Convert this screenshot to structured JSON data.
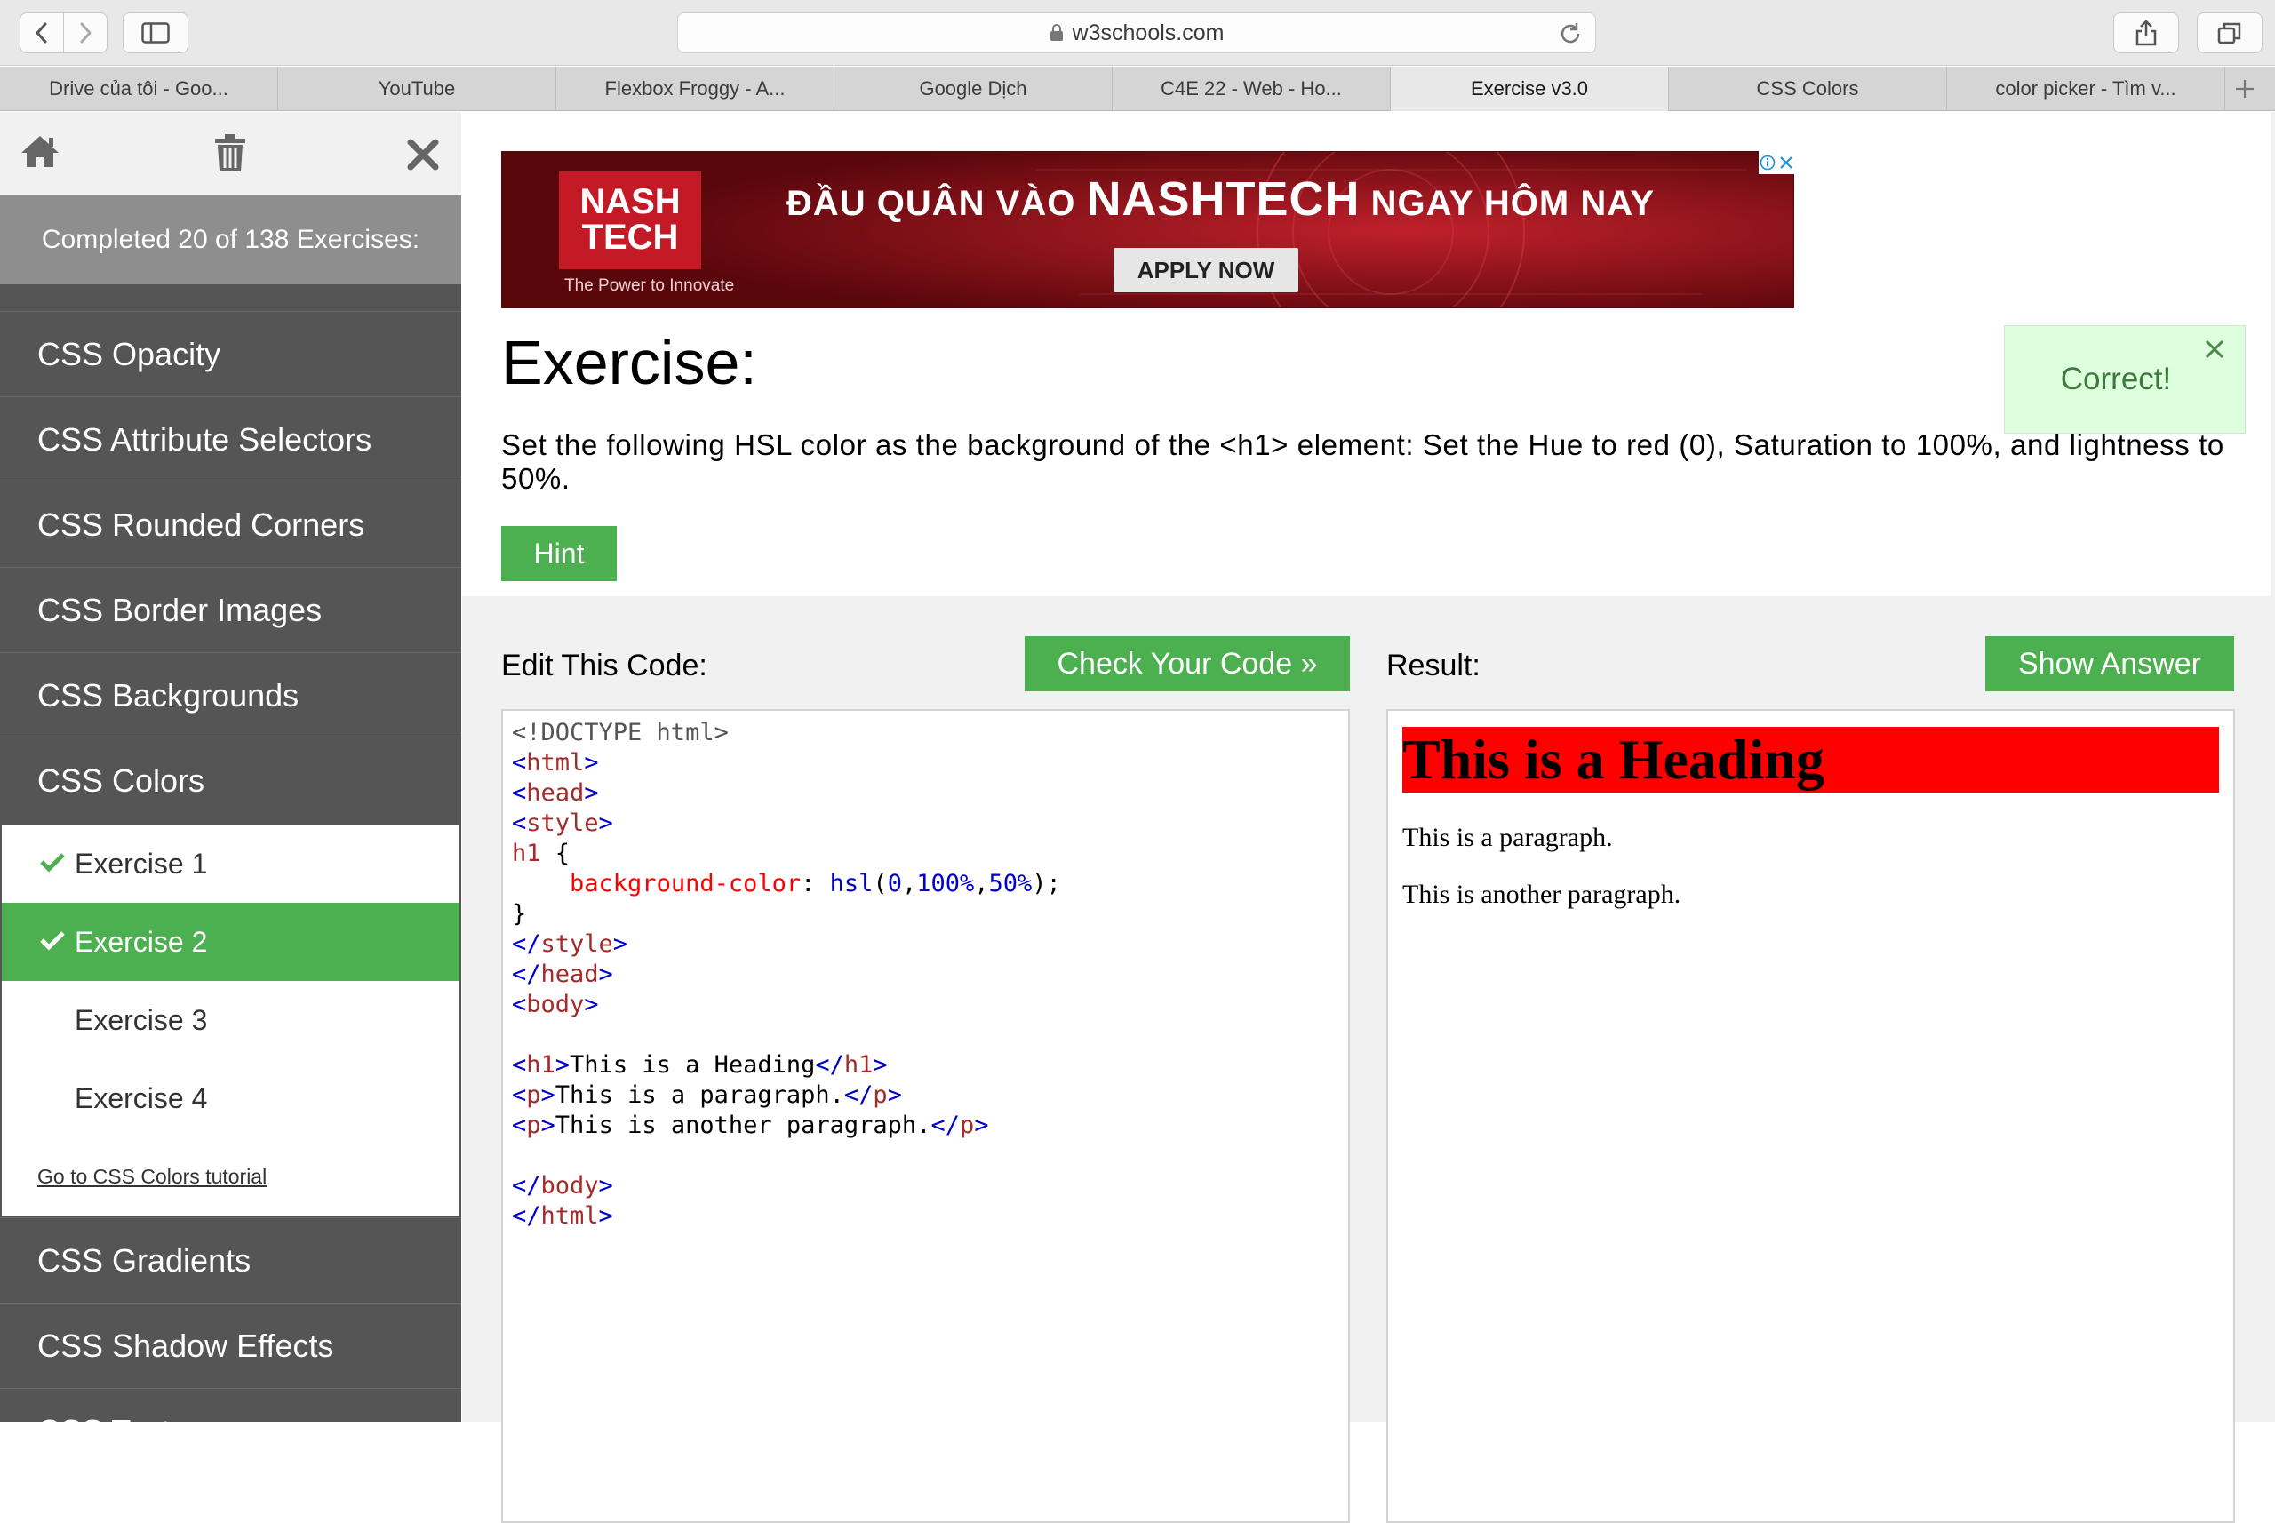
{
  "browser": {
    "url": "w3schools.com",
    "tabs": [
      {
        "label": "Drive của tôi - Goo..."
      },
      {
        "label": "YouTube"
      },
      {
        "label": "Flexbox Froggy - A..."
      },
      {
        "label": "Google Dịch"
      },
      {
        "label": "C4E 22 - Web - Ho..."
      },
      {
        "label": "Exercise v3.0"
      },
      {
        "label": "CSS Colors"
      },
      {
        "label": "color picker - Tìm v..."
      }
    ],
    "active_tab": "Exercise v3.0"
  },
  "sidebar": {
    "progress": "Completed 20 of 138 Exercises:",
    "categories_before": [
      {
        "label": "CSS Opacity"
      },
      {
        "label": "CSS Attribute Selectors"
      },
      {
        "label": "CSS Rounded Corners"
      },
      {
        "label": "CSS Border Images"
      },
      {
        "label": "CSS Backgrounds"
      },
      {
        "label": "CSS Colors"
      }
    ],
    "exercises": [
      {
        "label": "Exercise 1",
        "done": true
      },
      {
        "label": "Exercise 2",
        "done": true,
        "active": true
      },
      {
        "label": "Exercise 3",
        "done": false
      },
      {
        "label": "Exercise 4",
        "done": false
      }
    ],
    "tutorial_link": "Go to CSS Colors tutorial",
    "categories_after": [
      {
        "label": "CSS Gradients"
      },
      {
        "label": "CSS Shadow Effects"
      },
      {
        "label": "CSS Text"
      }
    ]
  },
  "ad": {
    "logo_line1": "NASH",
    "logo_line2": "TECH",
    "tagline": "The Power to Innovate",
    "headline_pre": "ĐẦU QUÂN VÀO",
    "headline_brand": "NASHTECH",
    "headline_post": "NGAY HÔM NAY",
    "cta": "APPLY NOW"
  },
  "exercise": {
    "title": "Exercise:",
    "feedback": "Correct!",
    "question": "Set the following HSL color as the background of the <h1> element: Set the Hue to red (0), Saturation to 100%, and lightness to 50%.",
    "hint_label": "Hint",
    "edit_label": "Edit This Code:",
    "check_label": "Check Your Code »",
    "result_label": "Result:",
    "answer_label": "Show Answer"
  },
  "code": {
    "doctype": "<!DOCTYPE html>",
    "selector": "h1",
    "property": "background-color",
    "value_fn": "hsl",
    "value_h": "0",
    "value_s": "100%",
    "value_l": "50%",
    "h1_text": "This is a Heading",
    "p1_text": "This is a paragraph.",
    "p2_text": "This is another paragraph."
  },
  "result": {
    "heading": "This is a Heading",
    "p1": "This is a paragraph.",
    "p2": "This is another paragraph.",
    "heading_bg": "#ff0000"
  },
  "colors": {
    "accent": "#4caf50",
    "sidebar_bg": "#555555",
    "feedback_bg": "#ddffdd",
    "ad_bg": "#8a0d14"
  }
}
